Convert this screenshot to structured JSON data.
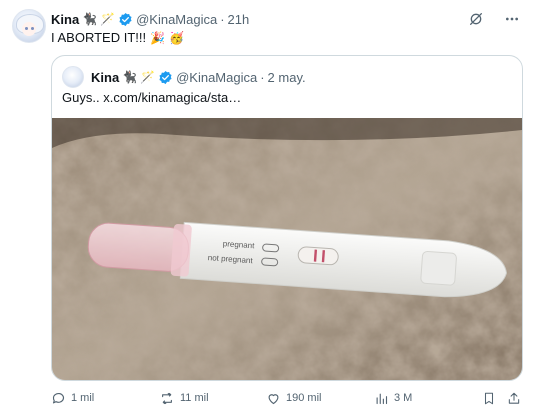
{
  "tweet": {
    "author_name": "Kina",
    "author_emojis": [
      "🐈‍⬛",
      "🪄"
    ],
    "handle": "@KinaMagica",
    "separator": "·",
    "time": "21h",
    "text": "I ABORTED IT!!!",
    "text_emojis": [
      "🎉",
      "🥳"
    ]
  },
  "quoted": {
    "author_name": "Kina",
    "author_emojis": [
      "🐈‍⬛",
      "🪄"
    ],
    "handle": "@KinaMagica",
    "separator": "·",
    "date": "2 may.",
    "text": "Guys..",
    "link": "x.com/kinamagica/sta…",
    "test_labels": {
      "positive": "pregnant",
      "negative": "not pregnant"
    }
  },
  "actions": {
    "replies": "1 mil",
    "reposts": "11 mil",
    "likes": "190 mil",
    "views": "3 M"
  },
  "colors": {
    "verified": "#1d9bf0",
    "muted": "#536471",
    "border": "#cfd9de"
  },
  "icons": [
    "grok-icon",
    "more-icon",
    "verified-icon",
    "reply-icon",
    "repost-icon",
    "like-icon",
    "views-icon",
    "bookmark-icon",
    "share-icon"
  ]
}
